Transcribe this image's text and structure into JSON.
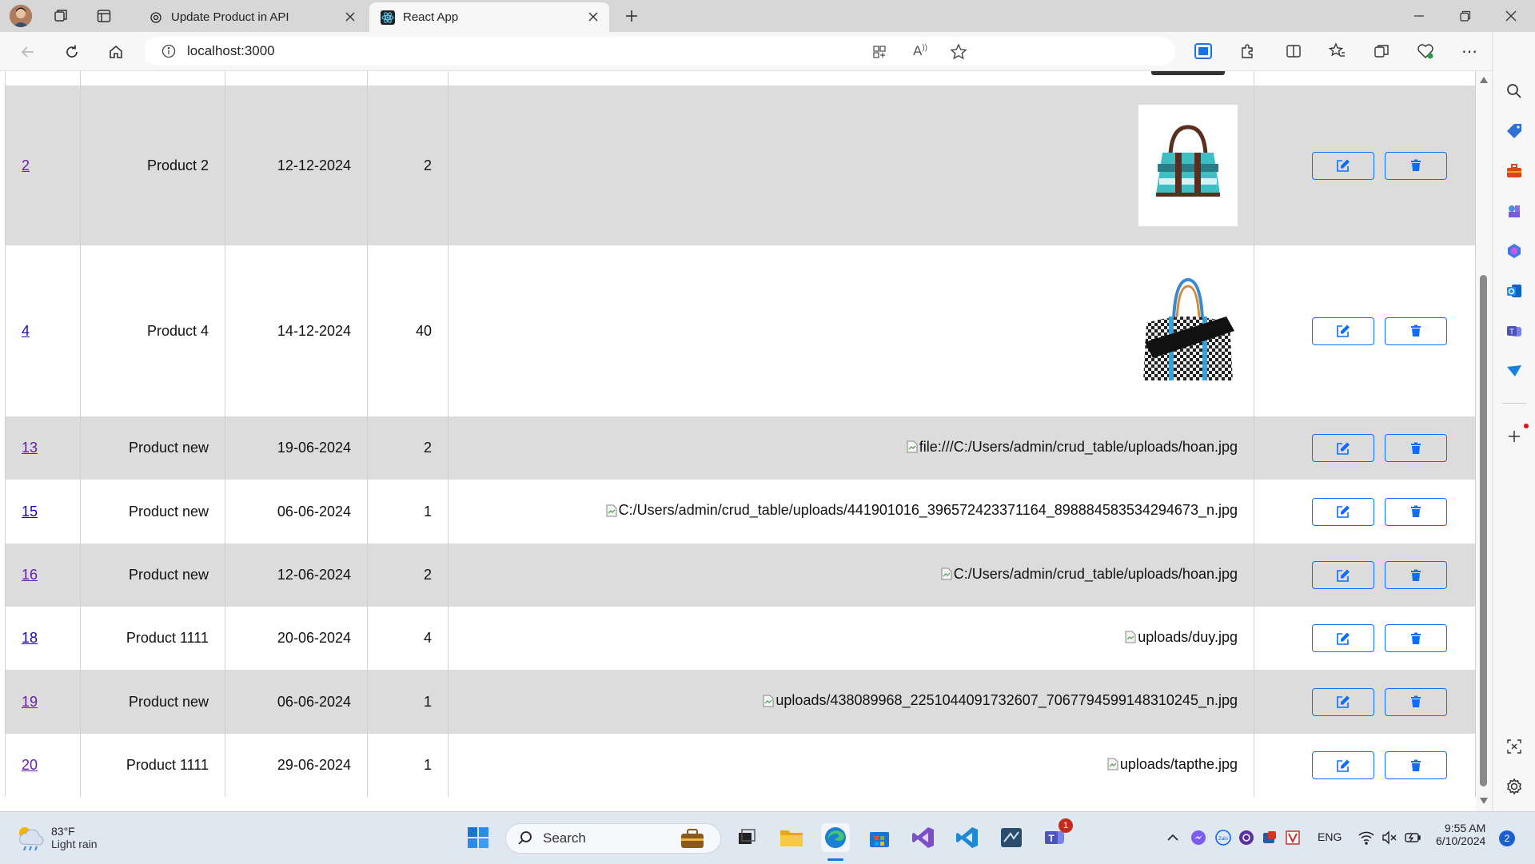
{
  "browser": {
    "tabs": [
      {
        "title": "Update Product in API"
      },
      {
        "title": "React App"
      }
    ],
    "url": "localhost:3000"
  },
  "table": {
    "rows": [
      {
        "id": "2",
        "name": "Product 2",
        "date": "12-12-2024",
        "qty": "2",
        "image": "bag-teal",
        "image_alt": ""
      },
      {
        "id": "4",
        "name": "Product 4",
        "date": "14-12-2024",
        "qty": "40",
        "image": "bag-checkered",
        "image_alt": ""
      },
      {
        "id": "13",
        "name": "Product new",
        "date": "19-06-2024",
        "qty": "2",
        "image": "broken",
        "image_alt": "file:///C:/Users/admin/crud_table/uploads/hoan.jpg"
      },
      {
        "id": "15",
        "name": "Product new",
        "date": "06-06-2024",
        "qty": "1",
        "image": "broken",
        "image_alt": "C:/Users/admin/crud_table/uploads/441901016_396572423371164_898884583534294673_n.jpg"
      },
      {
        "id": "16",
        "name": "Product new",
        "date": "12-06-2024",
        "qty": "2",
        "image": "broken",
        "image_alt": "C:/Users/admin/crud_table/uploads/hoan.jpg"
      },
      {
        "id": "18",
        "name": "Product 1111",
        "date": "20-06-2024",
        "qty": "4",
        "image": "broken",
        "image_alt": "uploads/duy.jpg"
      },
      {
        "id": "19",
        "name": "Product new",
        "date": "06-06-2024",
        "qty": "1",
        "image": "broken",
        "image_alt": "uploads/438089968_2251044091732607_7067794599148310245_n.jpg"
      },
      {
        "id": "20",
        "name": "Product 1111",
        "date": "29-06-2024",
        "qty": "1",
        "image": "broken",
        "image_alt": "uploads/tapthe.jpg"
      }
    ],
    "actions": {
      "edit_icon": "edit-icon",
      "delete_icon": "trash-icon"
    }
  },
  "taskbar": {
    "weather": {
      "temp": "83°F",
      "condition": "Light rain"
    },
    "search_placeholder": "Search",
    "teams_badge": "1",
    "language": "ENG",
    "time": "9:55 AM",
    "date": "6/10/2024",
    "notification_count": "2"
  },
  "colors": {
    "accent": "#0d6efd",
    "row_alt": "#dcdcdc",
    "link": "#1a0dab",
    "link_visited": "#681da8"
  }
}
